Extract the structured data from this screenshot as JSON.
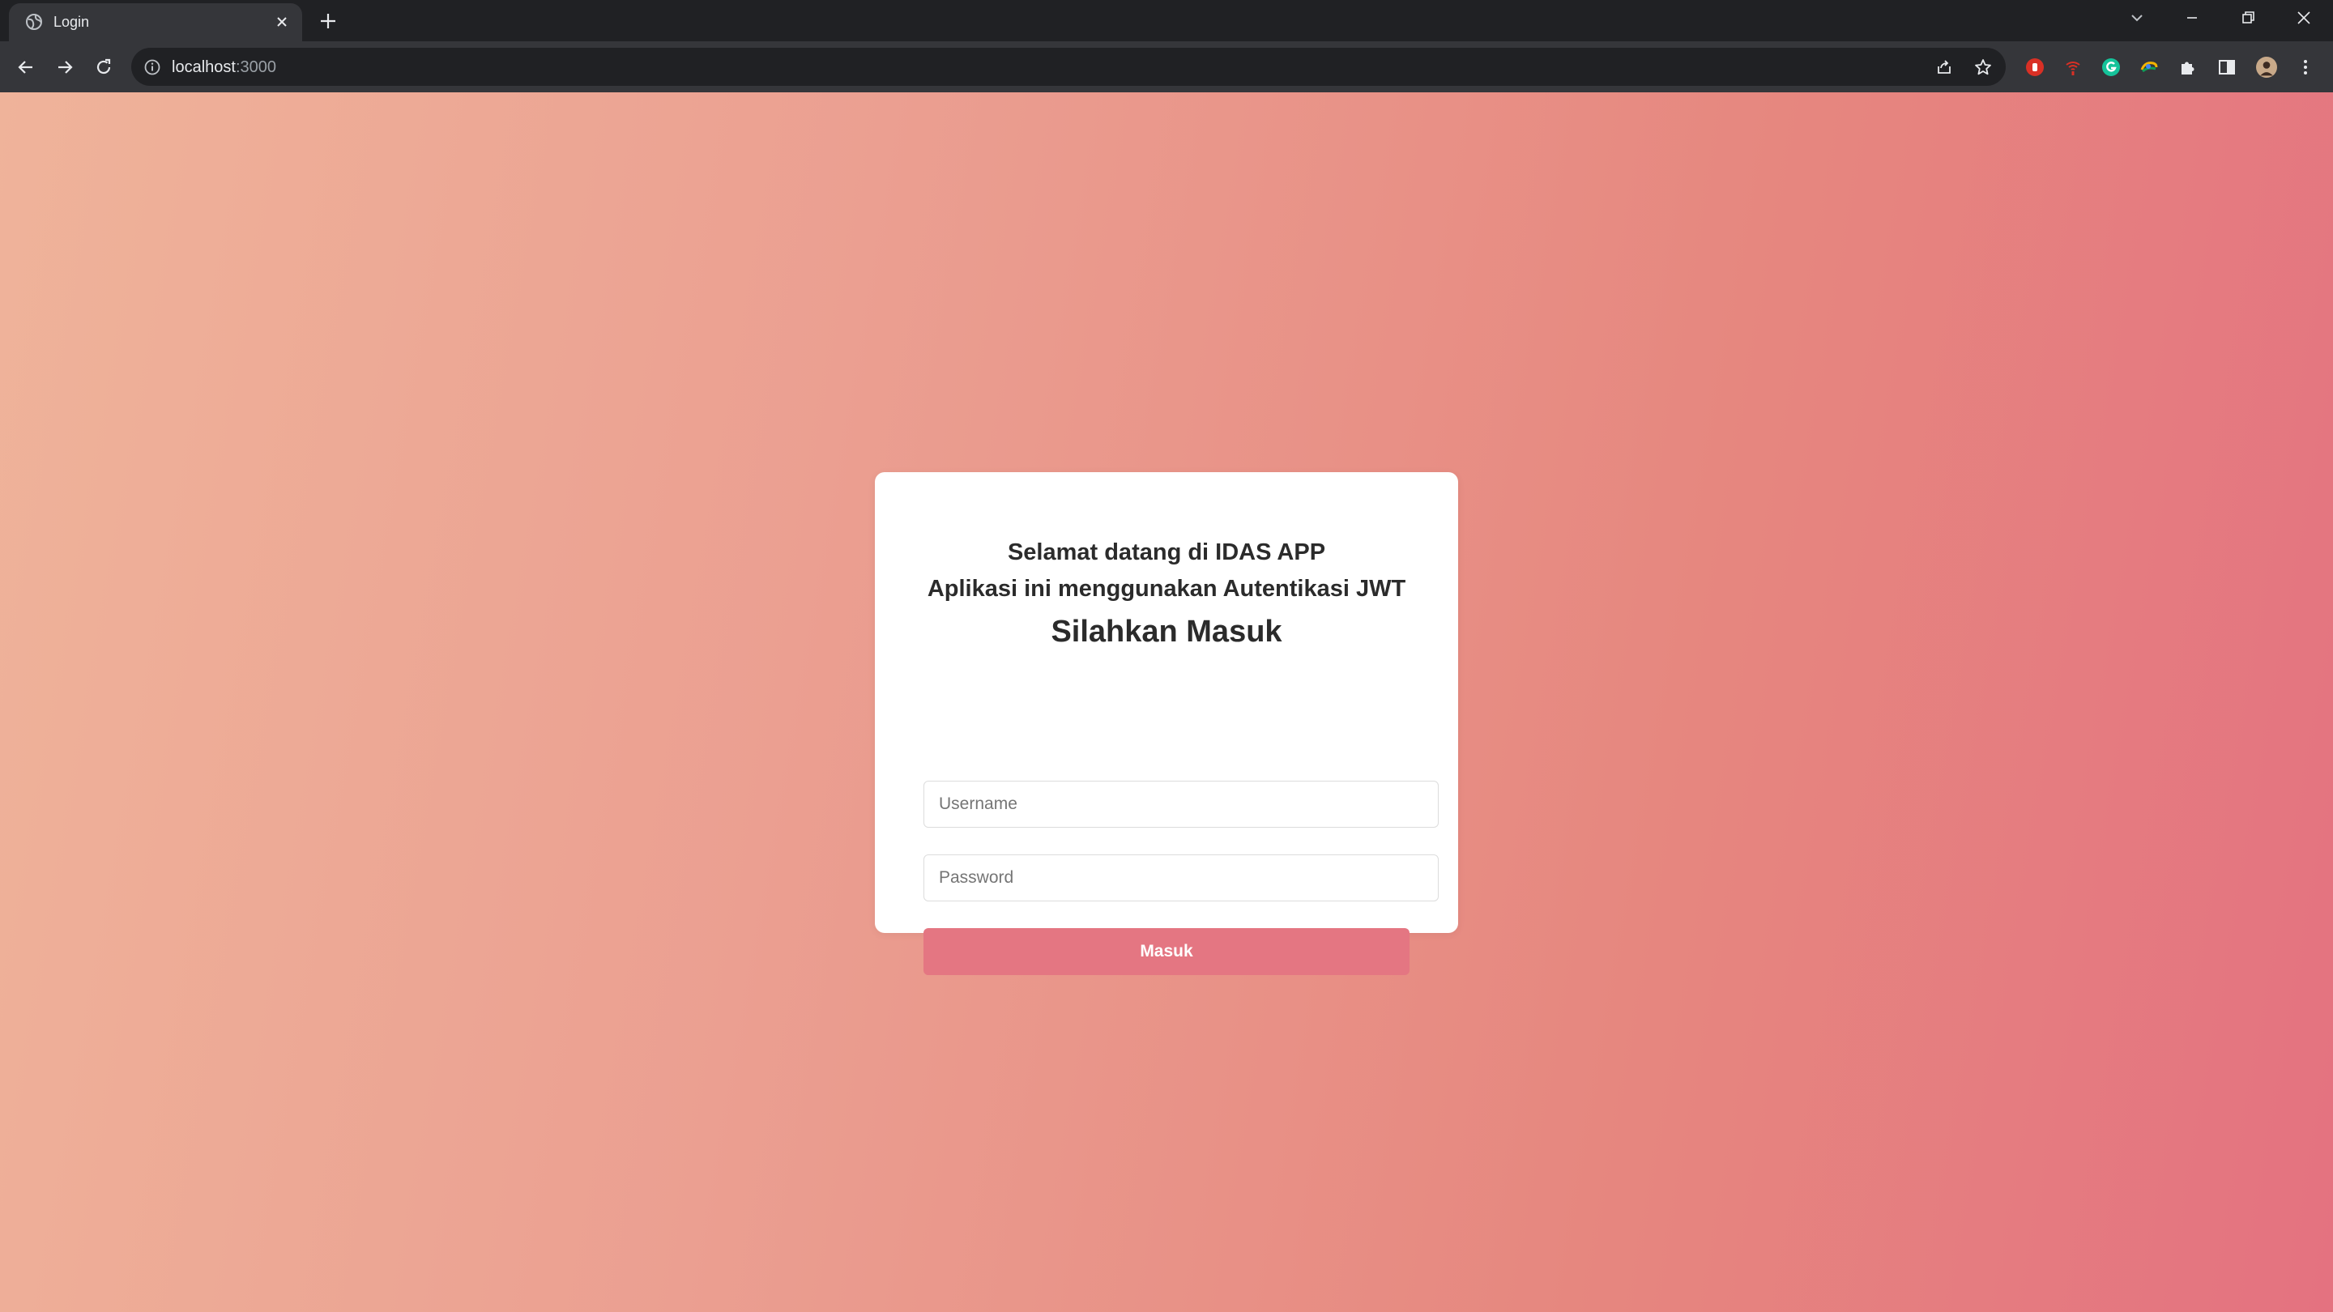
{
  "browser": {
    "tab_title": "Login",
    "url_host": "localhost",
    "url_port": ":3000"
  },
  "page": {
    "welcome_line1": "Selamat datang di IDAS APP",
    "welcome_line2": "Aplikasi ini menggunakan Autentikasi JWT",
    "heading": "Silahkan Masuk",
    "username_placeholder": "Username",
    "password_placeholder": "Password",
    "submit_label": "Masuk"
  },
  "colors": {
    "gradient_start": "#efb39a",
    "gradient_end": "#e47280",
    "button": "#e47682"
  }
}
